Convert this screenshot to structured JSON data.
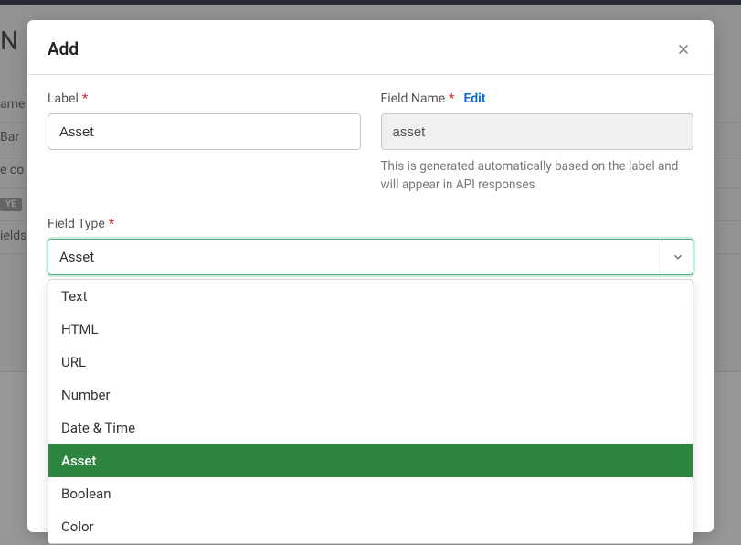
{
  "background": {
    "title": "N",
    "rows": [
      "ame",
      "Bar",
      "e co",
      "YE",
      "ields"
    ]
  },
  "modal": {
    "title": "Add",
    "label_field": {
      "label": "Label",
      "value": "Asset"
    },
    "field_name": {
      "label": "Field Name",
      "edit_link": "Edit",
      "value": "asset",
      "help": "This is generated automatically based on the label and will appear in API responses"
    },
    "field_type": {
      "label": "Field Type",
      "selected": "Asset",
      "options": [
        "Text",
        "HTML",
        "URL",
        "Number",
        "Date & Time",
        "Asset",
        "Boolean",
        "Color"
      ]
    }
  }
}
